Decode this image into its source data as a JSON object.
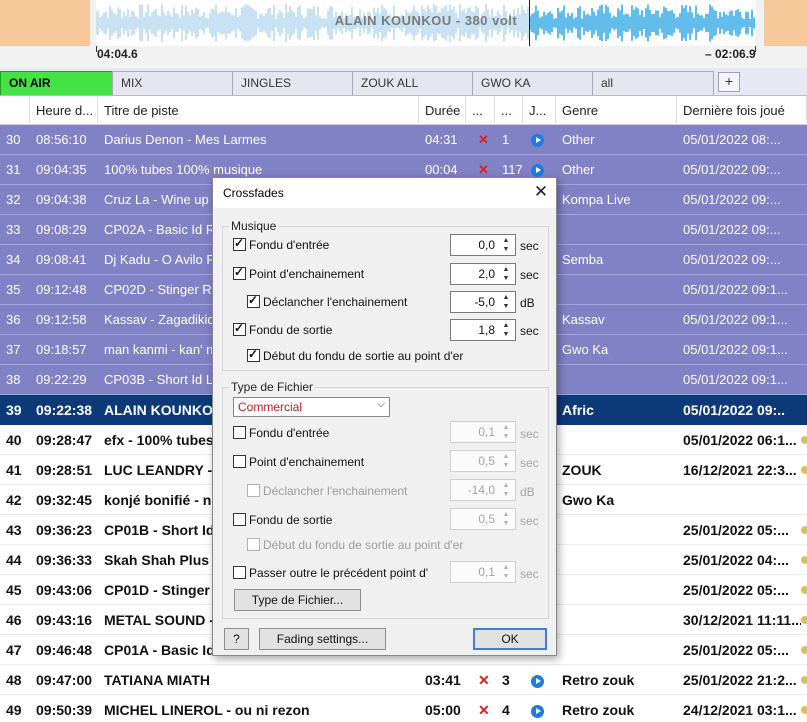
{
  "header": {
    "track_title": "ALAIN KOUNKOU  -  380 volt",
    "elapsed": "04:04.6",
    "remaining": "– 02:06.9"
  },
  "tabs": [
    {
      "label": "ON AIR",
      "active": true
    },
    {
      "label": "MIX"
    },
    {
      "label": "JINGLES"
    },
    {
      "label": "ZOUK ALL"
    },
    {
      "label": "GWO KA"
    },
    {
      "label": "all"
    }
  ],
  "tab_add_label": "+",
  "columns": [
    "",
    "Heure d...",
    "Titre de piste",
    "Durée",
    "...",
    "...",
    "J...",
    "Genre",
    "Dernière fois joué"
  ],
  "rows": [
    {
      "n": "30",
      "time": "08:56:10",
      "title": "Darius Denon - Mes Larmes",
      "duration": "04:31",
      "x": "✕",
      "count": "1",
      "genre": "Other",
      "last": "05/01/2022 08:...",
      "state": "played"
    },
    {
      "n": "31",
      "time": "09:04:35",
      "title": "100% tubes 100% musique",
      "duration": "00:04",
      "x": "✕",
      "count": "117",
      "genre": "Other",
      "last": "05/01/2022 09:...",
      "state": "played"
    },
    {
      "n": "32",
      "time": "09:04:38",
      "title": "Cruz La - Wine up",
      "duration": "",
      "x": "",
      "count": "",
      "genre": "Kompa Live",
      "last": "05/01/2022 09:...",
      "state": "played"
    },
    {
      "n": "33",
      "time": "09:08:29",
      "title": "CP02A - Basic Id Ro",
      "duration": "",
      "x": "",
      "count": "",
      "genre": "",
      "last": "05/01/2022 09:...",
      "state": "played"
    },
    {
      "n": "34",
      "time": "09:08:41",
      "title": "Dj Kadu - O Avilo F",
      "duration": "",
      "x": "",
      "count": "",
      "genre": "Semba",
      "last": "05/01/2022 09:...",
      "state": "played"
    },
    {
      "n": "35",
      "time": "09:12:48",
      "title": "CP02D - Stinger Ro",
      "duration": "",
      "x": "",
      "count": "",
      "genre": "",
      "last": "05/01/2022 09:1...",
      "state": "played"
    },
    {
      "n": "36",
      "time": "09:12:58",
      "title": "Kassav - Zagadikid",
      "duration": "",
      "x": "",
      "count": "",
      "genre": "Kassav",
      "last": "05/01/2022 09:1...",
      "state": "played"
    },
    {
      "n": "37",
      "time": "09:18:57",
      "title": "man kanmi - kan' n",
      "duration": "",
      "x": "",
      "count": "",
      "genre": "Gwo Ka",
      "last": "05/01/2022 09:1...",
      "state": "played"
    },
    {
      "n": "38",
      "time": "09:22:29",
      "title": "CP03B - Short Id La",
      "duration": "",
      "x": "",
      "count": "",
      "genre": "",
      "last": "05/01/2022 09:1...",
      "state": "played"
    },
    {
      "n": "39",
      "time": "09:22:38",
      "title": "ALAIN KOUNKOU",
      "duration": "",
      "x": "",
      "count": "",
      "genre": "Afric",
      "last": "05/01/2022 09:..",
      "state": "current"
    },
    {
      "n": "40",
      "time": "09:28:47",
      "title": "efx - 100% tubes",
      "duration": "",
      "x": "",
      "count": "",
      "genre": "",
      "last": "05/01/2022 06:1...",
      "state": "upcoming"
    },
    {
      "n": "41",
      "time": "09:28:51",
      "title": "LUC LEANDRY -",
      "duration": "",
      "x": "",
      "count": "",
      "genre": "ZOUK",
      "last": "16/12/2021 22:3...",
      "state": "upcoming"
    },
    {
      "n": "42",
      "time": "09:32:45",
      "title": "konjé bonifié - n",
      "duration": "",
      "x": "",
      "count": "",
      "genre": "Gwo Ka",
      "last": "",
      "state": "upcoming"
    },
    {
      "n": "43",
      "time": "09:36:23",
      "title": "CP01B - Short Id",
      "duration": "",
      "x": "",
      "count": "",
      "genre": "",
      "last": "25/01/2022 05:...",
      "state": "upcoming"
    },
    {
      "n": "44",
      "time": "09:36:33",
      "title": "Skah Shah Plus A",
      "duration": "",
      "x": "",
      "count": "",
      "genre": "",
      "last": "25/01/2022 04:...",
      "state": "upcoming"
    },
    {
      "n": "45",
      "time": "09:43:06",
      "title": "CP01D - Stinger",
      "duration": "",
      "x": "",
      "count": "",
      "genre": "",
      "last": "25/01/2022 05:...",
      "state": "upcoming"
    },
    {
      "n": "46",
      "time": "09:43:16",
      "title": "METAL SOUND -",
      "duration": "",
      "x": "",
      "count": "",
      "genre": "",
      "last": "30/12/2021 11:11...",
      "state": "upcoming"
    },
    {
      "n": "47",
      "time": "09:46:48",
      "title": "CP01A - Basic Id",
      "duration": "",
      "x": "",
      "count": "",
      "genre": "",
      "last": "25/01/2022 05:...",
      "state": "upcoming"
    },
    {
      "n": "48",
      "time": "09:47:00",
      "title": "TATIANA MIATH",
      "duration": "03:41",
      "x": "✕",
      "count": "3",
      "genre": "Retro zouk",
      "last": "25/01/2022 21:2...",
      "state": "upcoming"
    },
    {
      "n": "49",
      "time": "09:50:39",
      "title": "MICHEL LINEROL - ou ni rezon",
      "duration": "05:00",
      "x": "✕",
      "count": "4",
      "genre": "Retro zouk",
      "last": "24/12/2021 03:1...",
      "state": "upcoming"
    }
  ],
  "dialog": {
    "title": "Crossfades",
    "close": "✕",
    "musique": {
      "group_label": "Musique",
      "fade_in": {
        "label": "Fondu d'entrée",
        "checked": true,
        "value": "0,0",
        "unit": "sec"
      },
      "crossfade_point": {
        "label": "Point d'enchainement",
        "checked": true,
        "value": "2,0",
        "unit": "sec"
      },
      "trigger": {
        "label": "Déclancher l'enchainement",
        "checked": true,
        "value": "-5,0",
        "unit": "dB"
      },
      "fade_out": {
        "label": "Fondu de sortie",
        "checked": true,
        "value": "1,8",
        "unit": "sec"
      },
      "fade_out_at_point": {
        "label": "Début du fondu de sortie au point d'er",
        "checked": true
      }
    },
    "file_type": {
      "group_label": "Type de Fichier",
      "selected": "Commercial",
      "fade_in": {
        "label": "Fondu d'entrée",
        "checked": false,
        "value": "0,1",
        "unit": "sec"
      },
      "crossfade_point": {
        "label": "Point d'enchainement",
        "checked": false,
        "value": "0,5",
        "unit": "sec"
      },
      "trigger": {
        "label": "Déclancher l'enchainement",
        "checked": false,
        "value": "-14,0",
        "unit": "dB"
      },
      "fade_out": {
        "label": "Fondu de sortie",
        "checked": false,
        "value": "0,5",
        "unit": "sec"
      },
      "fade_out_at_point": {
        "label": "Début du fondu de sortie au point d'er",
        "checked": false
      },
      "skip_previous": {
        "label": "Passer outre le précédent point d'",
        "checked": false,
        "value": "0,1",
        "unit": "sec"
      },
      "file_type_button": "Type de Fichier..."
    },
    "help_button": "?",
    "fading_settings_button": "Fading settings...",
    "ok_button": "OK"
  },
  "colors": {
    "on_air_tab": "#44e344",
    "played_row": "#8181c5",
    "current_row": "#0c3a78",
    "annotation": "#e02020"
  }
}
